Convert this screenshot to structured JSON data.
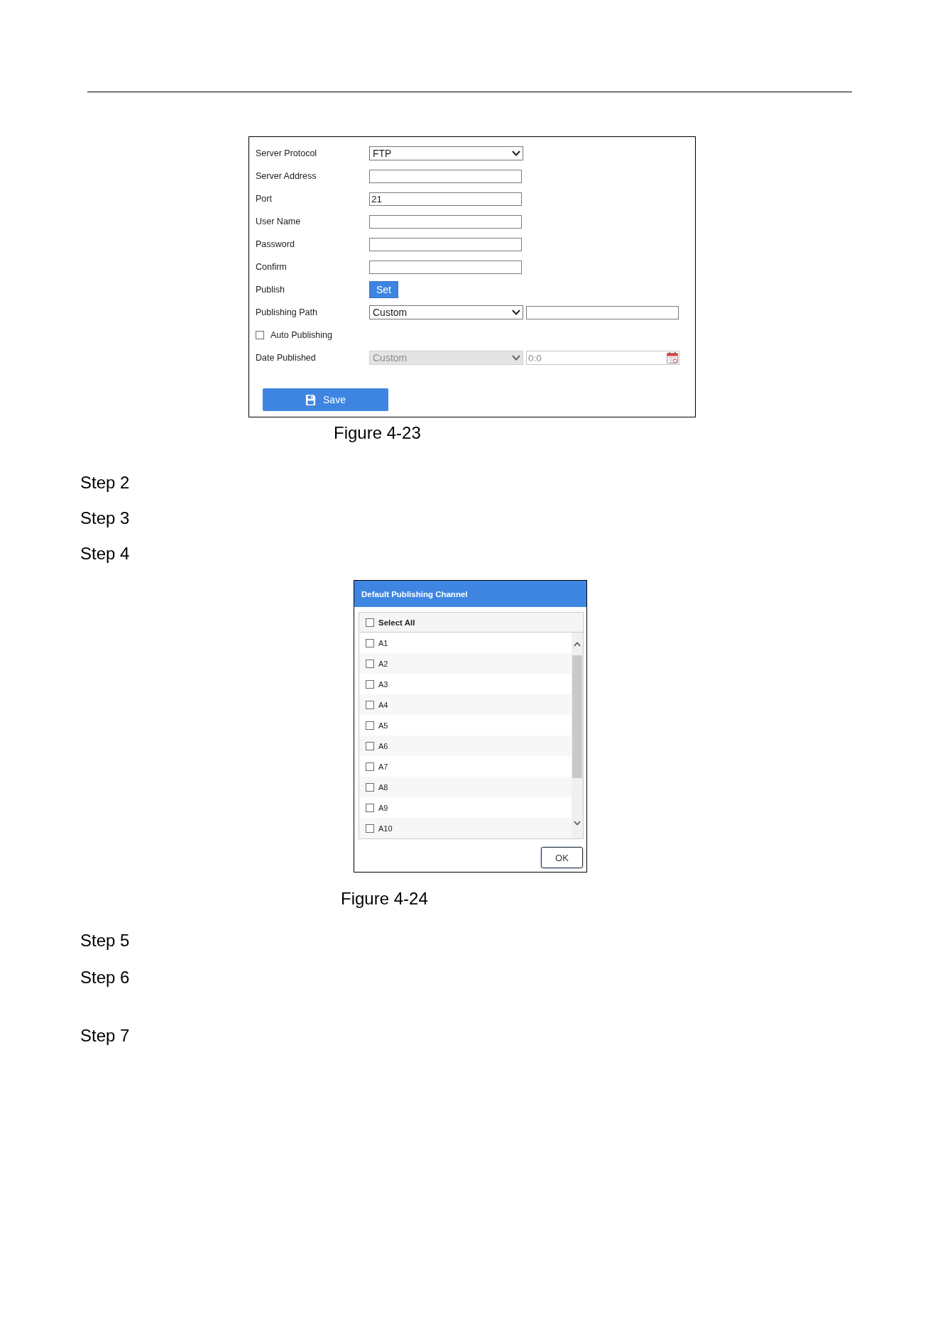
{
  "figure_1": {
    "form": {
      "fields": [
        {
          "kind": "row",
          "label": "Server Protocol",
          "controls": [
            {
              "kind": "select",
              "value": "FTP",
              "disabled": false
            }
          ]
        },
        {
          "kind": "row",
          "label": "Server Address",
          "controls": [
            {
              "kind": "input",
              "disabled": false
            }
          ]
        },
        {
          "kind": "row",
          "label": "Port",
          "controls": [
            {
              "kind": "input",
              "value": "21",
              "disabled": false
            }
          ]
        },
        {
          "kind": "row",
          "label": "User Name",
          "controls": [
            {
              "kind": "input",
              "disabled": false
            }
          ]
        },
        {
          "kind": "row",
          "label": "Password",
          "controls": [
            {
              "kind": "input",
              "disabled": false
            }
          ]
        },
        {
          "kind": "row",
          "label": "Confirm",
          "controls": [
            {
              "kind": "input",
              "disabled": false
            }
          ]
        },
        {
          "kind": "row",
          "label": "Publish",
          "controls": [
            {
              "kind": "button",
              "text": "Set",
              "disabled": false
            }
          ]
        },
        {
          "kind": "row",
          "label": "Publishing Path",
          "controls": [
            {
              "kind": "select",
              "value": "Custom",
              "disabled": false
            },
            {
              "kind": "input",
              "disabled": false
            }
          ]
        },
        {
          "kind": "checkbox",
          "label": "Auto Publishing",
          "checked": false
        },
        {
          "kind": "row",
          "label": "Date Published",
          "controls": [
            {
              "kind": "select",
              "value": "Custom",
              "disabled": true
            },
            {
              "kind": "date",
              "value": "0:0",
              "disabled": true
            }
          ]
        }
      ],
      "save_button": "Save"
    },
    "caption": "Figure 4-23"
  },
  "steps_1": [
    "Step 2",
    "Step 3",
    "Step 4"
  ],
  "figure_2": {
    "dialog": {
      "title": "Default Publishing Channel",
      "select_all": {
        "label": "Select All",
        "checked": false
      },
      "channels": [
        {
          "label": "A1",
          "checked": false
        },
        {
          "label": "A2",
          "checked": false
        },
        {
          "label": "A3",
          "checked": false
        },
        {
          "label": "A4",
          "checked": false
        },
        {
          "label": "A5",
          "checked": false
        },
        {
          "label": "A6",
          "checked": false
        },
        {
          "label": "A7",
          "checked": false
        },
        {
          "label": "A8",
          "checked": false
        },
        {
          "label": "A9",
          "checked": false
        },
        {
          "label": "A10",
          "checked": false
        }
      ],
      "ok_button": "OK"
    },
    "caption": "Figure 4-24"
  },
  "steps_2": [
    "Step 5",
    "Step 6",
    "Step 7"
  ]
}
